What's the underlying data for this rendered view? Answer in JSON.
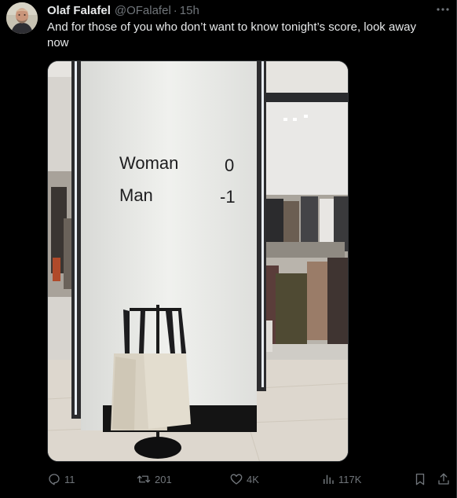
{
  "author": {
    "display_name": "Olaf Falafel",
    "handle": "@OFalafel",
    "separator": "·",
    "time": "15h"
  },
  "tweet": {
    "text": "And for those of you who don’t want to know tonight’s score, look away now"
  },
  "media": {
    "sign": {
      "row1_label": "Woman",
      "row1_score": "0",
      "row2_label": "Man",
      "row2_score": "-1"
    }
  },
  "actions": {
    "replies": "11",
    "reposts": "201",
    "likes": "4K",
    "views": "117K"
  },
  "icons": {
    "more": "more-dots-icon",
    "reply": "reply-icon",
    "repost": "repost-icon",
    "like": "heart-icon",
    "views": "views-bar-chart-icon",
    "bookmark": "bookmark-icon",
    "share": "share-icon"
  },
  "colors": {
    "background": "#000000",
    "text": "#e7e9ea",
    "secondary": "#71767b",
    "border": "#2f3336"
  }
}
